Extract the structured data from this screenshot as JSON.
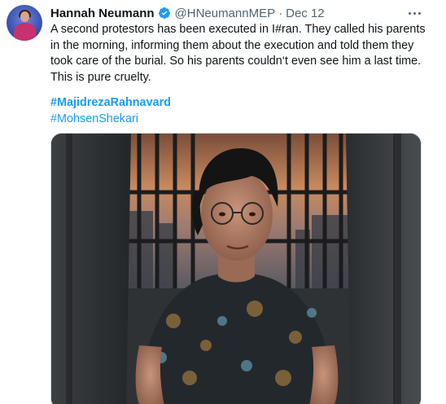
{
  "tweet": {
    "author_name": "Hannah Neumann",
    "handle": "@HNeumannMEP",
    "separator": "·",
    "date": "Dec 12",
    "text": "A second protestors has been executed in I#ran. They called his parents in the morning, informing them about the execution and told them they took care of the burial. So his parents couldn‘t even see him a last time. This is pure cruelty.",
    "hashtags": [
      "#MajidrezaRahnavard",
      "#MohsenShekari"
    ]
  },
  "icons": {
    "verified": "verified-badge-icon",
    "more": "more-options-icon"
  },
  "colors": {
    "link": "#1d9bf0",
    "verified": "#1d9bf0",
    "secondary_text": "#536471"
  }
}
